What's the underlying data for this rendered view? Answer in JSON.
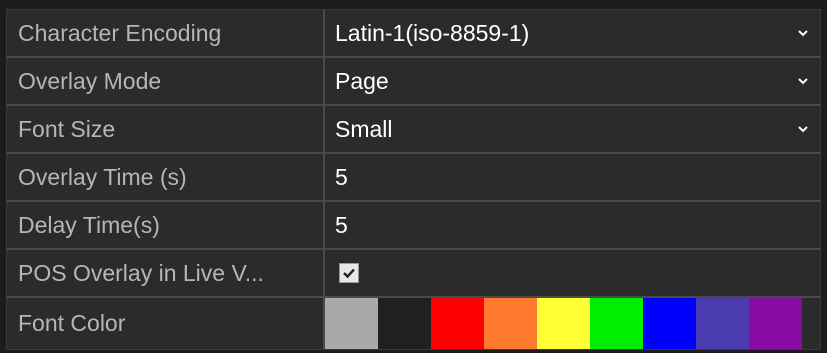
{
  "settings": {
    "character_encoding": {
      "label": "Character Encoding",
      "value": "Latin-1(iso-8859-1)"
    },
    "overlay_mode": {
      "label": "Overlay Mode",
      "value": "Page"
    },
    "font_size": {
      "label": "Font Size",
      "value": "Small"
    },
    "overlay_time": {
      "label": "Overlay Time (s)",
      "value": "5"
    },
    "delay_time": {
      "label": "Delay Time(s)",
      "value": "5"
    },
    "pos_overlay_live_view": {
      "label": "POS Overlay in Live V...",
      "checked": true
    },
    "font_color": {
      "label": "Font Color",
      "swatches": [
        "#a9a9a9",
        "#202020",
        "#ff0000",
        "#ff7a2f",
        "#ffff33",
        "#00ee00",
        "#0000ff",
        "#4b3bb0",
        "#8a0aa6"
      ]
    }
  },
  "icons": {
    "dropdown": "chevron-down-icon",
    "check": "checkmark-icon"
  }
}
